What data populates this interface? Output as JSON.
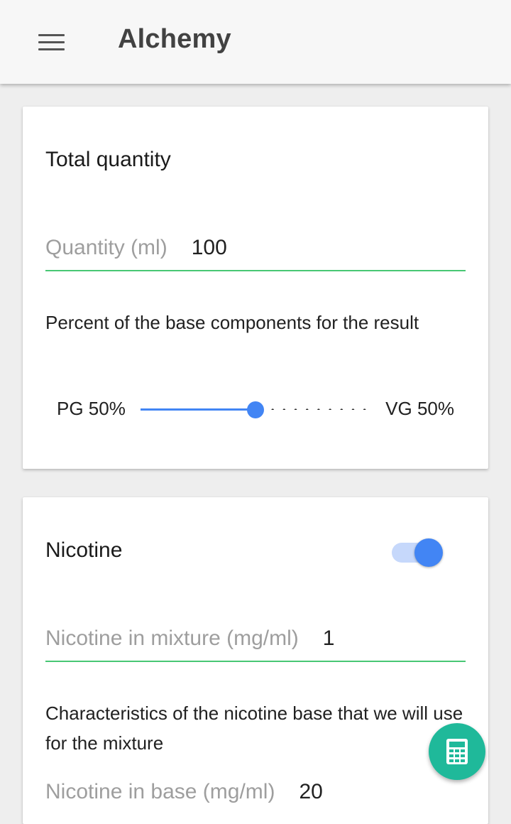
{
  "app": {
    "title": "Alchemy",
    "menu_icon": "menu-icon"
  },
  "total_quantity_card": {
    "title": "Total quantity",
    "quantity_label": "Quantity (ml)",
    "quantity_value": "100",
    "base_description": "Percent of the base components for the result",
    "pg_label": "PG 50%",
    "vg_label": "VG 50%",
    "pg_percent": 50
  },
  "nicotine_card": {
    "title": "Nicotine",
    "enabled": true,
    "mixture_label": "Nicotine in mixture (mg/ml)",
    "mixture_value": "1",
    "base_description": "Characteristics of the nicotine base that we will use for the mixture",
    "base_label": "Nicotine in base (mg/ml)",
    "base_value": "20"
  },
  "fab": {
    "icon": "calculator-icon"
  },
  "colors": {
    "accent": "#4285f4",
    "underline": "#48c774",
    "fab": "#1fb99a",
    "appbar": "#f7f7f7"
  }
}
